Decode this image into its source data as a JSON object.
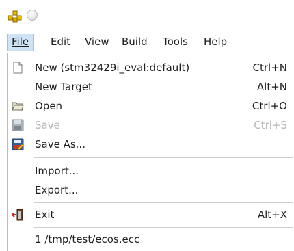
{
  "menubar": {
    "file": "File",
    "edit": "Edit",
    "view": "View",
    "build": "Build",
    "tools": "Tools",
    "help": "Help"
  },
  "file_menu": {
    "new": {
      "label": "New   (stm32429i_eval:default)",
      "accel": "Ctrl+N"
    },
    "new_target": {
      "label": "New Target",
      "accel": "Alt+N"
    },
    "open": {
      "label": "Open",
      "accel": "Ctrl+O"
    },
    "save": {
      "label": "Save",
      "accel": "Ctrl+S",
      "enabled": false
    },
    "save_as": {
      "label": "Save As..."
    },
    "import": {
      "label": "Import..."
    },
    "export": {
      "label": "Export..."
    },
    "exit": {
      "label": "Exit",
      "accel": "Alt+X"
    },
    "recent_1": {
      "label": "1 /tmp/test/ecos.ecc"
    }
  },
  "icons": {
    "app": "app-icon",
    "new": "new-document-icon",
    "open": "folder-open-icon",
    "save": "floppy-disk-icon",
    "save_as": "save-as-icon",
    "exit": "exit-door-icon"
  },
  "colors": {
    "menu_highlight": "#cfe3f6",
    "menu_highlight_border": "#9ec3e6",
    "disabled_text": "#b8b8b8"
  }
}
